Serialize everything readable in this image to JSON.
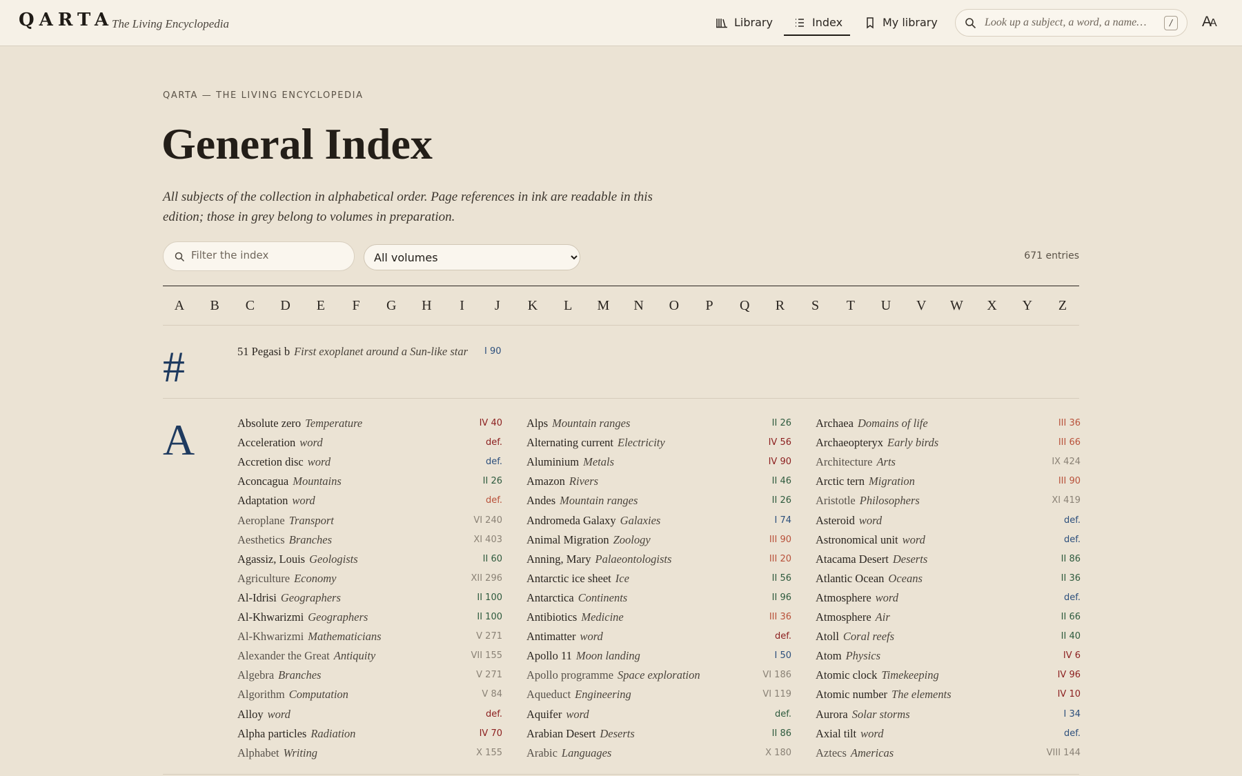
{
  "header": {
    "brand": "QARTA",
    "tagline": "The Living Encyclopedia",
    "nav": [
      {
        "label": "Library",
        "icon": "library-icon"
      },
      {
        "label": "Index",
        "icon": "index-list-icon"
      },
      {
        "label": "My library",
        "icon": "bookmark-icon"
      }
    ],
    "search_placeholder": "Look up a subject, a word, a name…",
    "search_shortcut": "/",
    "font_toggle": "AA"
  },
  "page": {
    "eyebrow": "QARTA — THE LIVING ENCYCLOPEDIA",
    "title": "General Index",
    "lede": "All subjects of the collection in alphabetical order. Page references in ink are readable in this edition; those in grey belong to volumes in preparation."
  },
  "filters": {
    "filter_placeholder": "Filter the index",
    "volume_selected": "All volumes",
    "entry_count": "671 entries"
  },
  "alphabet": [
    "A",
    "B",
    "C",
    "D",
    "E",
    "F",
    "G",
    "H",
    "I",
    "J",
    "K",
    "L",
    "M",
    "N",
    "O",
    "P",
    "Q",
    "R",
    "S",
    "T",
    "U",
    "V",
    "W",
    "X",
    "Y",
    "Z"
  ],
  "colors": {
    "blue": "#2c4f7c",
    "red": "#8b1e1e",
    "orange": "#b8513a",
    "green": "#2d5a3d",
    "grey": "#8a8276"
  },
  "sections": {
    "hash": {
      "letter": "#",
      "entries": [
        {
          "term": "51 Pegasi b",
          "context": "First exoplanet around a Sun-like star",
          "ref": "I 90",
          "color": "blue"
        }
      ]
    },
    "a": {
      "letter": "A",
      "columns": [
        [
          {
            "term": "Absolute zero",
            "context": "Temperature",
            "ref": "IV 40",
            "color": "red"
          },
          {
            "term": "Acceleration",
            "context": "word",
            "ref": "def.",
            "color": "red"
          },
          {
            "term": "Accretion disc",
            "context": "word",
            "ref": "def.",
            "color": "blue"
          },
          {
            "term": "Aconcagua",
            "context": "Mountains",
            "ref": "II 26",
            "color": "green"
          },
          {
            "term": "Adaptation",
            "context": "word",
            "ref": "def.",
            "color": "orange"
          },
          {
            "term": "Aeroplane",
            "context": "Transport",
            "ref": "VI 240",
            "color": "grey"
          },
          {
            "term": "Aesthetics",
            "context": "Branches",
            "ref": "XI 403",
            "color": "grey"
          },
          {
            "term": "Agassiz, Louis",
            "context": "Geologists",
            "ref": "II 60",
            "color": "green"
          },
          {
            "term": "Agriculture",
            "context": "Economy",
            "ref": "XII 296",
            "color": "grey"
          },
          {
            "term": "Al-Idrisi",
            "context": "Geographers",
            "ref": "II 100",
            "color": "green"
          },
          {
            "term": "Al-Khwarizmi",
            "context": "Geographers",
            "ref": "II 100",
            "color": "green"
          },
          {
            "term": "Al-Khwarizmi",
            "context": "Mathematicians",
            "ref": "V 271",
            "color": "grey"
          },
          {
            "term": "Alexander the Great",
            "context": "Antiquity",
            "ref": "VII 155",
            "color": "grey"
          },
          {
            "term": "Algebra",
            "context": "Branches",
            "ref": "V 271",
            "color": "grey"
          },
          {
            "term": "Algorithm",
            "context": "Computation",
            "ref": "V 84",
            "color": "grey"
          },
          {
            "term": "Alloy",
            "context": "word",
            "ref": "def.",
            "color": "red"
          },
          {
            "term": "Alpha particles",
            "context": "Radiation",
            "ref": "IV 70",
            "color": "red"
          },
          {
            "term": "Alphabet",
            "context": "Writing",
            "ref": "X 155",
            "color": "grey"
          }
        ],
        [
          {
            "term": "Alps",
            "context": "Mountain ranges",
            "ref": "II 26",
            "color": "green"
          },
          {
            "term": "Alternating current",
            "context": "Electricity",
            "ref": "IV 56",
            "color": "red"
          },
          {
            "term": "Aluminium",
            "context": "Metals",
            "ref": "IV 90",
            "color": "red"
          },
          {
            "term": "Amazon",
            "context": "Rivers",
            "ref": "II 46",
            "color": "green"
          },
          {
            "term": "Andes",
            "context": "Mountain ranges",
            "ref": "II 26",
            "color": "green"
          },
          {
            "term": "Andromeda Galaxy",
            "context": "Galaxies",
            "ref": "I 74",
            "color": "blue"
          },
          {
            "term": "Animal Migration",
            "context": "Zoology",
            "ref": "III 90",
            "color": "orange"
          },
          {
            "term": "Anning, Mary",
            "context": "Palaeontologists",
            "ref": "III 20",
            "color": "orange"
          },
          {
            "term": "Antarctic ice sheet",
            "context": "Ice",
            "ref": "II 56",
            "color": "green"
          },
          {
            "term": "Antarctica",
            "context": "Continents",
            "ref": "II 96",
            "color": "green"
          },
          {
            "term": "Antibiotics",
            "context": "Medicine",
            "ref": "III 36",
            "color": "orange"
          },
          {
            "term": "Antimatter",
            "context": "word",
            "ref": "def.",
            "color": "red"
          },
          {
            "term": "Apollo 11",
            "context": "Moon landing",
            "ref": "I 50",
            "color": "blue"
          },
          {
            "term": "Apollo programme",
            "context": "Space exploration",
            "ref": "VI 186",
            "color": "grey"
          },
          {
            "term": "Aqueduct",
            "context": "Engineering",
            "ref": "VI 119",
            "color": "grey"
          },
          {
            "term": "Aquifer",
            "context": "word",
            "ref": "def.",
            "color": "green"
          },
          {
            "term": "Arabian Desert",
            "context": "Deserts",
            "ref": "II 86",
            "color": "green"
          },
          {
            "term": "Arabic",
            "context": "Languages",
            "ref": "X 180",
            "color": "grey"
          }
        ],
        [
          {
            "term": "Archaea",
            "context": "Domains of life",
            "ref": "III 36",
            "color": "orange"
          },
          {
            "term": "Archaeopteryx",
            "context": "Early birds",
            "ref": "III 66",
            "color": "orange"
          },
          {
            "term": "Architecture",
            "context": "Arts",
            "ref": "IX 424",
            "color": "grey"
          },
          {
            "term": "Arctic tern",
            "context": "Migration",
            "ref": "III 90",
            "color": "orange"
          },
          {
            "term": "Aristotle",
            "context": "Philosophers",
            "ref": "XI 419",
            "color": "grey"
          },
          {
            "term": "Asteroid",
            "context": "word",
            "ref": "def.",
            "color": "blue"
          },
          {
            "term": "Astronomical unit",
            "context": "word",
            "ref": "def.",
            "color": "blue"
          },
          {
            "term": "Atacama Desert",
            "context": "Deserts",
            "ref": "II 86",
            "color": "green"
          },
          {
            "term": "Atlantic Ocean",
            "context": "Oceans",
            "ref": "II 36",
            "color": "green"
          },
          {
            "term": "Atmosphere",
            "context": "word",
            "ref": "def.",
            "color": "blue"
          },
          {
            "term": "Atmosphere",
            "context": "Air",
            "ref": "II 66",
            "color": "green"
          },
          {
            "term": "Atoll",
            "context": "Coral reefs",
            "ref": "II 40",
            "color": "green"
          },
          {
            "term": "Atom",
            "context": "Physics",
            "ref": "IV 6",
            "color": "red"
          },
          {
            "term": "Atomic clock",
            "context": "Timekeeping",
            "ref": "IV 96",
            "color": "red"
          },
          {
            "term": "Atomic number",
            "context": "The elements",
            "ref": "IV 10",
            "color": "red"
          },
          {
            "term": "Aurora",
            "context": "Solar storms",
            "ref": "I 34",
            "color": "blue"
          },
          {
            "term": "Axial tilt",
            "context": "word",
            "ref": "def.",
            "color": "blue"
          },
          {
            "term": "Aztecs",
            "context": "Americas",
            "ref": "VIII 144",
            "color": "grey"
          }
        ]
      ]
    }
  }
}
